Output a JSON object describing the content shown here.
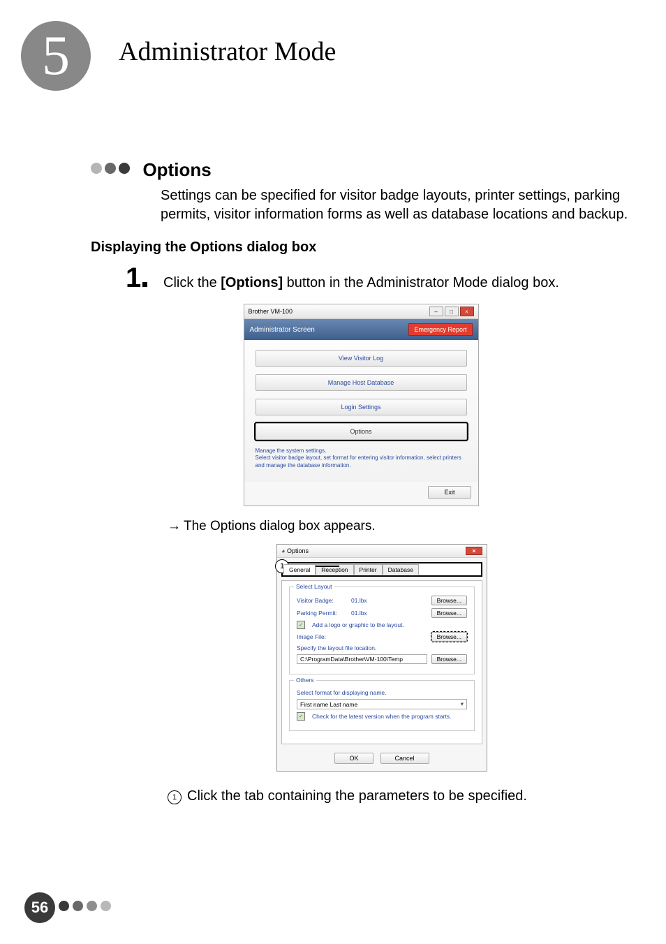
{
  "chapter": {
    "number": "5",
    "title": "Administrator Mode"
  },
  "section": {
    "title": "Options",
    "description": "Settings can be specified for visitor badge layouts, printer settings, parking permits, visitor information forms as well as database locations and backup."
  },
  "subheading": "Displaying the Options dialog box",
  "step1": {
    "number": "1",
    "text_before": "Click the ",
    "bold": "[Options]",
    "text_after": " button in the Administrator Mode dialog box."
  },
  "admin_window": {
    "titlebar": "Brother VM-100",
    "header": "Administrator Screen",
    "emergency": "Emergency Report",
    "buttons": {
      "view_log": "View Visitor Log",
      "manage_host": "Manage Host Database",
      "login_settings": "Login Settings",
      "options": "Options"
    },
    "note_title": "Manage the system settings.",
    "note_body": "Select visitor badge layout, set format for entering visitor information, select printers and manage the database information.",
    "exit": "Exit"
  },
  "result_text": "The Options dialog box appears.",
  "options_dialog": {
    "title": "Options",
    "tabs": {
      "general": "General",
      "reception": "Reception",
      "printer": "Printer",
      "database": "Database"
    },
    "group_layout": {
      "title": "Select Layout",
      "visitor_badge_lbl": "Visitor Badge:",
      "visitor_badge_val": "01.lbx",
      "parking_permit_lbl": "Parking Permit:",
      "parking_permit_val": "01.lbx",
      "add_logo": "Add a logo or graphic to the layout.",
      "image_file_lbl": "Image File:",
      "specify_loc": "Specify the layout file location.",
      "loc_value": "C:\\ProgramData\\Brother\\VM-100\\Temp",
      "browse": "Browse...",
      "browse2": "Browse..."
    },
    "group_others": {
      "title": "Others",
      "name_format_lbl": "Select format for displaying name.",
      "name_format_val": "First name Last name",
      "check_update": "Check for the latest version when the program starts."
    },
    "ok": "OK",
    "cancel": "Cancel"
  },
  "callout1_text": "Click the tab containing the parameters to be specified.",
  "page_number": "56"
}
